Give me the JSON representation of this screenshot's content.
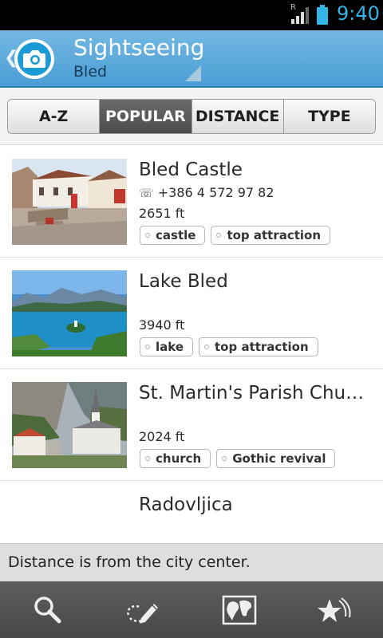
{
  "status_bar": {
    "time": "9:40",
    "roaming_indicator": "R",
    "icons": [
      "signal-icon",
      "battery-icon"
    ],
    "accent_color": "#33b5e5"
  },
  "header": {
    "title": "Sightseeing",
    "subtitle": "Bled",
    "icons": [
      "back-chevron-icon",
      "camera-logo-icon",
      "dropdown-corner-icon"
    ],
    "background_color": "#5aaad9"
  },
  "tabs": [
    {
      "label": "A-Z",
      "active": false
    },
    {
      "label": "POPULAR",
      "active": true
    },
    {
      "label": "DISTANCE",
      "active": false
    },
    {
      "label": "TYPE",
      "active": false
    }
  ],
  "places": [
    {
      "name": "Bled Castle",
      "phone": "+386 4 572 97 82",
      "distance": "2651 ft",
      "tags": [
        "castle",
        "top attraction"
      ],
      "thumbnail": "castle-courtyard-photo"
    },
    {
      "name": "Lake Bled",
      "phone": "",
      "distance": "3940 ft",
      "tags": [
        "lake",
        "top attraction"
      ],
      "thumbnail": "lake-island-photo"
    },
    {
      "name": "St. Martin's Parish Church",
      "phone": "",
      "distance": "2024 ft",
      "tags": [
        "church",
        "Gothic revival"
      ],
      "thumbnail": "church-photo"
    },
    {
      "name": "Radovljica",
      "phone": "",
      "distance": "",
      "tags": [],
      "thumbnail": ""
    }
  ],
  "footer_note": "Distance is from the city center.",
  "bottom_bar": {
    "buttons": [
      "search-icon",
      "edit-icon",
      "map-icon",
      "favorites-icon"
    ]
  }
}
